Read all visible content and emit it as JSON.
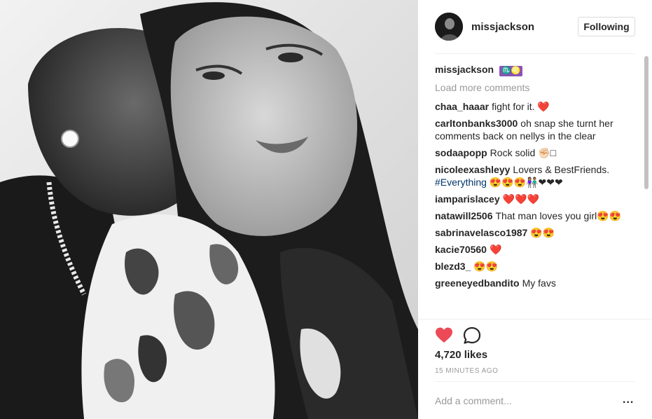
{
  "post": {
    "username": "missjackson",
    "follow_label": "Following",
    "caption_badge": "♏♌",
    "load_more_label": "Load more comments",
    "likes": "4,720 likes",
    "timestamp": "15 MINUTES AGO",
    "add_comment_placeholder": "Add a comment...",
    "more_label": "..."
  },
  "comments": [
    {
      "user": "chaa_haaar",
      "text": "fight for it. ❤️"
    },
    {
      "user": "carltonbanks3000",
      "text": "oh snap she turnt her comments back on nellys in the clear"
    },
    {
      "user": "sodaapopp",
      "text": "Rock solid ✊🏻□"
    },
    {
      "user": "nicoleexashleyy",
      "text": "Lovers & BestFriends.",
      "hashtag": "#Everything",
      "after": " 😍😍😍👫🏽❤❤❤"
    },
    {
      "user": "iamparislacey",
      "text": "❤️❤️❤️"
    },
    {
      "user": "natawill2506",
      "text": "That man loves you girl😍😍"
    },
    {
      "user": "sabrinavelasco1987",
      "text": "😍😍"
    },
    {
      "user": "kacie70560",
      "text": "❤️"
    },
    {
      "user": "blezd3_",
      "text": "😍😍"
    },
    {
      "user": "greeneyedbandito",
      "text": "My favs"
    }
  ],
  "icons": {
    "like": "heart-icon",
    "comment": "comment-bubble-icon",
    "more": "more-options-icon"
  },
  "colors": {
    "like_red": "#ed4956",
    "hashtag_blue": "#003569",
    "muted_gray": "#999999",
    "text_dark": "#262626"
  }
}
